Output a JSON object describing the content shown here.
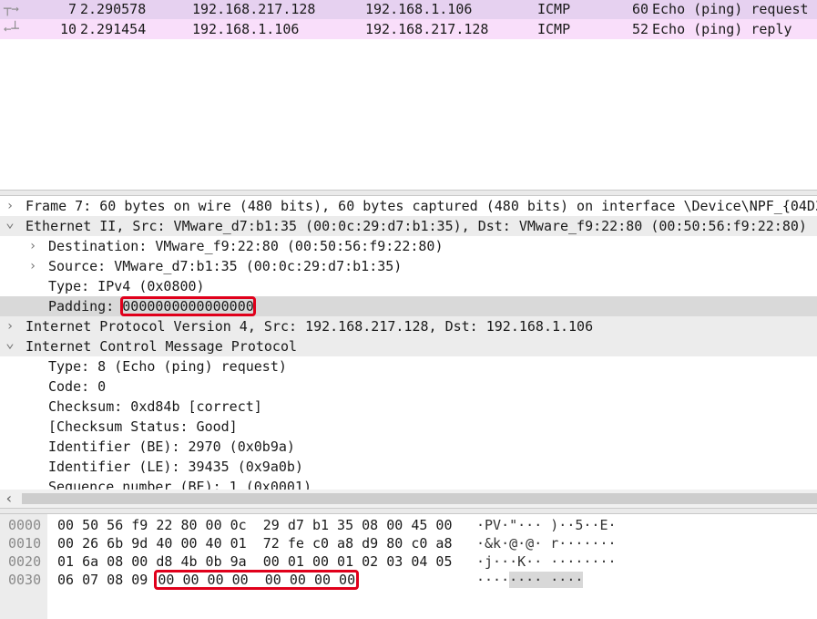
{
  "packet_list": {
    "rows": [
      {
        "no": "7",
        "time": "2.290578",
        "source": "192.168.217.128",
        "destination": "192.168.1.106",
        "protocol": "ICMP",
        "length": "60",
        "info": "Echo (ping) request",
        "arrow": "request",
        "bg": "#e6d1f0"
      },
      {
        "no": "10",
        "time": "2.291454",
        "source": "192.168.1.106",
        "destination": "192.168.217.128",
        "protocol": "ICMP",
        "length": "52",
        "info": "Echo (ping) reply",
        "arrow": "reply",
        "bg": "#f9defa"
      }
    ]
  },
  "details": {
    "rows": [
      {
        "level": 0,
        "toggle": "collapsed",
        "text": "Frame 7: 60 bytes on wire (480 bits), 60 bytes captured (480 bits) on interface \\Device\\NPF_{04D3",
        "bg": "#ffffff"
      },
      {
        "level": 0,
        "toggle": "expanded",
        "text": "Ethernet II, Src: VMware_d7:b1:35 (00:0c:29:d7:b1:35), Dst: VMware_f9:22:80 (00:50:56:f9:22:80)",
        "bg": "#ececec"
      },
      {
        "level": 1,
        "toggle": "collapsed",
        "text": "Destination: VMware_f9:22:80 (00:50:56:f9:22:80)",
        "bg": "#ffffff"
      },
      {
        "level": 1,
        "toggle": "collapsed",
        "text": "Source: VMware_d7:b1:35 (00:0c:29:d7:b1:35)",
        "bg": "#ffffff"
      },
      {
        "level": 1,
        "toggle": "none",
        "text": "Type: IPv4 (0x0800)",
        "bg": "#ffffff"
      },
      {
        "level": 1,
        "toggle": "none",
        "label": "Padding: ",
        "value": "0000000000000000",
        "bg": "#d9d9d9",
        "highlight": true
      },
      {
        "level": 0,
        "toggle": "collapsed",
        "text": "Internet Protocol Version 4, Src: 192.168.217.128, Dst: 192.168.1.106",
        "bg": "#ececec"
      },
      {
        "level": 0,
        "toggle": "expanded",
        "text": "Internet Control Message Protocol",
        "bg": "#ececec"
      },
      {
        "level": 1,
        "toggle": "none",
        "text": "Type: 8 (Echo (ping) request)",
        "bg": "#ffffff"
      },
      {
        "level": 1,
        "toggle": "none",
        "text": "Code: 0",
        "bg": "#ffffff"
      },
      {
        "level": 1,
        "toggle": "none",
        "text": "Checksum: 0xd84b [correct]",
        "bg": "#ffffff"
      },
      {
        "level": 1,
        "toggle": "none",
        "text": "[Checksum Status: Good]",
        "bg": "#ffffff"
      },
      {
        "level": 1,
        "toggle": "none",
        "text": "Identifier (BE): 2970 (0x0b9a)",
        "bg": "#ffffff"
      },
      {
        "level": 1,
        "toggle": "none",
        "text": "Identifier (LE): 39435 (0x9a0b)",
        "bg": "#ffffff"
      },
      {
        "level": 1,
        "toggle": "none",
        "text": "Sequence number (BE): 1 (0x0001)",
        "bg": "#ffffff"
      }
    ]
  },
  "bytes": {
    "rows": [
      {
        "offset": "0000",
        "hex": "00 50 56 f9 22 80 00 0c  29 d7 b1 35 08 00 45 00",
        "ascii": "·PV·\"··· )··5··E·"
      },
      {
        "offset": "0010",
        "hex": "00 26 6b 9d 40 00 40 01  72 fe c0 a8 d9 80 c0 a8",
        "ascii": "·&k·@·@· r·······"
      },
      {
        "offset": "0020",
        "hex": "01 6a 08 00 d8 4b 0b 9a  00 01 00 01 02 03 04 05",
        "ascii": "·j···K·· ········"
      },
      {
        "offset": "0030",
        "hex_prefix": "06 07 08 09 ",
        "hex_highlight": "00 00 00 00  00 00 00 00",
        "ascii_prefix": "····",
        "ascii_highlight": "···· ····"
      }
    ]
  }
}
